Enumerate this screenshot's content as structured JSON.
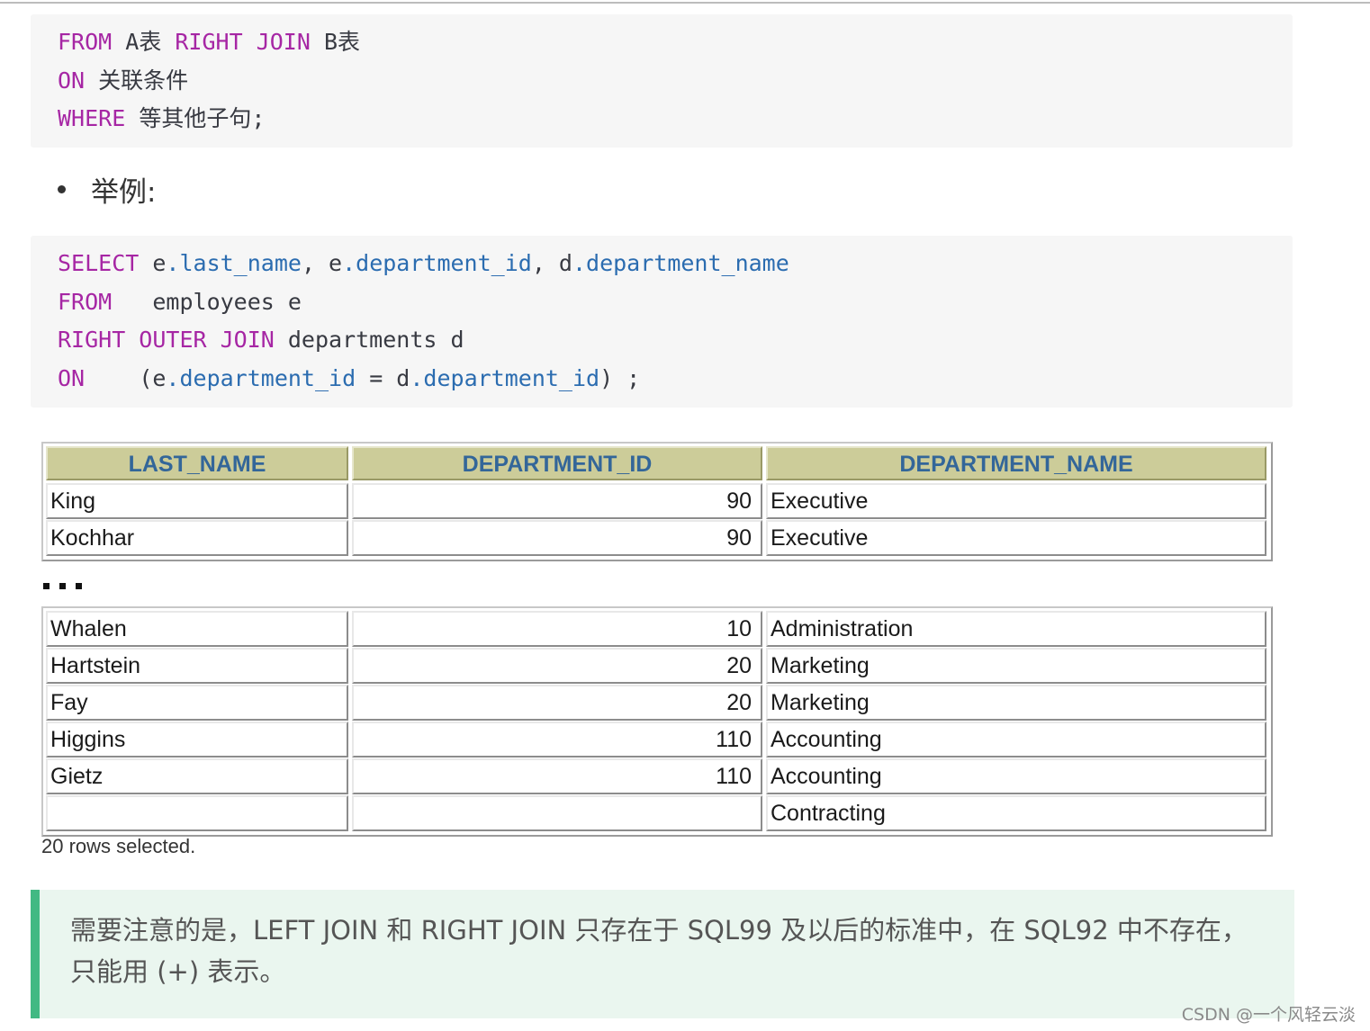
{
  "code1": {
    "lines": [
      [
        {
          "t": "FROM",
          "k": "kw"
        },
        {
          "t": " A表 ",
          "k": ""
        },
        {
          "t": "RIGHT JOIN",
          "k": "kw"
        },
        {
          "t": " B表",
          "k": ""
        }
      ],
      [
        {
          "t": "ON",
          "k": "kw"
        },
        {
          "t": " 关联条件",
          "k": ""
        }
      ],
      [
        {
          "t": "WHERE",
          "k": "kw"
        },
        {
          "t": " 等其他子句;",
          "k": ""
        }
      ]
    ]
  },
  "bullet": {
    "text": "举例:"
  },
  "code2": {
    "lines": [
      [
        {
          "t": "SELECT",
          "k": "kw"
        },
        {
          "t": " e",
          "k": ""
        },
        {
          "t": ".last_name",
          "k": "prop"
        },
        {
          "t": ", e",
          "k": ""
        },
        {
          "t": ".department_id",
          "k": "prop"
        },
        {
          "t": ", d",
          "k": ""
        },
        {
          "t": ".department_name",
          "k": "prop"
        }
      ],
      [
        {
          "t": "FROM",
          "k": "kw"
        },
        {
          "t": "   employees e",
          "k": ""
        }
      ],
      [
        {
          "t": "RIGHT OUTER JOIN",
          "k": "kw"
        },
        {
          "t": " departments d",
          "k": ""
        }
      ],
      [
        {
          "t": "ON",
          "k": "kw"
        },
        {
          "t": "    (e",
          "k": ""
        },
        {
          "t": ".department_id",
          "k": "prop"
        },
        {
          "t": " = d",
          "k": ""
        },
        {
          "t": ".department_id",
          "k": "prop"
        },
        {
          "t": ") ;",
          "k": ""
        }
      ]
    ]
  },
  "result": {
    "headers": [
      "LAST_NAME",
      "DEPARTMENT_ID",
      "DEPARTMENT_NAME"
    ],
    "rows_top": [
      [
        "King",
        "90",
        "Executive"
      ],
      [
        "Kochhar",
        "90",
        "Executive"
      ]
    ],
    "rows_bottom": [
      [
        "Whalen",
        "10",
        "Administration"
      ],
      [
        "Hartstein",
        "20",
        "Marketing"
      ],
      [
        "Fay",
        "20",
        "Marketing"
      ],
      [
        "Higgins",
        "110",
        "Accounting"
      ],
      [
        "Gietz",
        "110",
        "Accounting"
      ],
      [
        "",
        "",
        "Contracting"
      ]
    ],
    "footer": "20 rows selected.",
    "colors": {
      "header_bg": "#cccc99",
      "header_text": "#336699",
      "highlight": "#ee1c24"
    }
  },
  "note": {
    "text": "需要注意的是，LEFT JOIN 和 RIGHT JOIN 只存在于 SQL99 及以后的标准中，在 SQL92 中不存在，只能用 (+) 表示。",
    "accent": "#42b983"
  },
  "watermark": "CSDN @一个风轻云淡"
}
